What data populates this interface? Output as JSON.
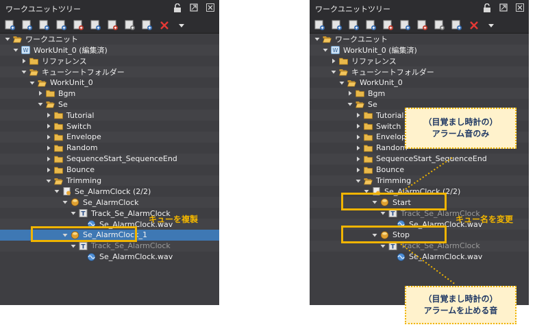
{
  "left_panel": {
    "title": "ワークユニットツリー",
    "rows": [
      {
        "label": "ワークユニット",
        "depth": 0,
        "icon": "folder-open",
        "arrow": "down"
      },
      {
        "label": "WorkUnit_0 (編集済)",
        "depth": 1,
        "icon": "workunit",
        "arrow": "down"
      },
      {
        "label": "リファレンス",
        "depth": 2,
        "icon": "folder",
        "arrow": "right"
      },
      {
        "label": "キューシートフォルダー",
        "depth": 2,
        "icon": "folder-open",
        "arrow": "down"
      },
      {
        "label": "WorkUnit_0",
        "depth": 3,
        "icon": "folder-open",
        "arrow": "down"
      },
      {
        "label": "Bgm",
        "depth": 4,
        "icon": "folder",
        "arrow": "right"
      },
      {
        "label": "Se",
        "depth": 4,
        "icon": "folder-open",
        "arrow": "down"
      },
      {
        "label": "Tutorial",
        "depth": 5,
        "icon": "folder",
        "arrow": "right"
      },
      {
        "label": "Switch",
        "depth": 5,
        "icon": "folder",
        "arrow": "right"
      },
      {
        "label": "Envelope",
        "depth": 5,
        "icon": "folder",
        "arrow": "right"
      },
      {
        "label": "Random",
        "depth": 5,
        "icon": "folder",
        "arrow": "right"
      },
      {
        "label": "SequenceStart_SequenceEnd",
        "depth": 5,
        "icon": "folder",
        "arrow": "right"
      },
      {
        "label": "Bounce",
        "depth": 5,
        "icon": "folder",
        "arrow": "right"
      },
      {
        "label": "Trimming",
        "depth": 5,
        "icon": "folder-open",
        "arrow": "down"
      },
      {
        "label": "Se_AlarmClock (2/2)",
        "depth": 6,
        "icon": "cuesheet",
        "arrow": "down"
      },
      {
        "label": "Se_AlarmClock",
        "depth": 7,
        "icon": "cue",
        "arrow": "down"
      },
      {
        "label": "Track_Se_AlarmClock",
        "depth": 8,
        "icon": "track",
        "arrow": "down"
      },
      {
        "label": "Se_AlarmClock.wav",
        "depth": 9,
        "icon": "wave",
        "arrow": "none"
      },
      {
        "label": "Se_AlarmClock_1",
        "depth": 7,
        "icon": "cue",
        "arrow": "down",
        "selected": true
      },
      {
        "label": "Track_Se_AlarmClock",
        "depth": 8,
        "icon": "track",
        "arrow": "down",
        "dim": true
      },
      {
        "label": "Se_AlarmClock.wav",
        "depth": 9,
        "icon": "wave",
        "arrow": "none"
      }
    ],
    "annotation": "キューを複製"
  },
  "right_panel": {
    "title": "ワークユニットツリー",
    "rows": [
      {
        "label": "ワークユニット",
        "depth": 0,
        "icon": "folder-open",
        "arrow": "down"
      },
      {
        "label": "WorkUnit_0 (編集済)",
        "depth": 1,
        "icon": "workunit",
        "arrow": "down"
      },
      {
        "label": "リファレンス",
        "depth": 2,
        "icon": "folder",
        "arrow": "right"
      },
      {
        "label": "キューシートフォルダー",
        "depth": 2,
        "icon": "folder-open",
        "arrow": "down"
      },
      {
        "label": "WorkUnit_0",
        "depth": 3,
        "icon": "folder-open",
        "arrow": "down"
      },
      {
        "label": "Bgm",
        "depth": 4,
        "icon": "folder",
        "arrow": "right"
      },
      {
        "label": "Se",
        "depth": 4,
        "icon": "folder-open",
        "arrow": "down"
      },
      {
        "label": "Tutorial",
        "depth": 5,
        "icon": "folder",
        "arrow": "right"
      },
      {
        "label": "Switch",
        "depth": 5,
        "icon": "folder",
        "arrow": "right"
      },
      {
        "label": "Envelope",
        "depth": 5,
        "icon": "folder",
        "arrow": "right"
      },
      {
        "label": "Random",
        "depth": 5,
        "icon": "folder",
        "arrow": "right"
      },
      {
        "label": "SequenceStart_SequenceEnd",
        "depth": 5,
        "icon": "folder",
        "arrow": "right"
      },
      {
        "label": "Bounce",
        "depth": 5,
        "icon": "folder",
        "arrow": "right"
      },
      {
        "label": "Trimming",
        "depth": 5,
        "icon": "folder-open",
        "arrow": "down"
      },
      {
        "label": "Se_AlarmClock (2/2)",
        "depth": 6,
        "icon": "cuesheet",
        "arrow": "down"
      },
      {
        "label": "Start",
        "depth": 7,
        "icon": "cue",
        "arrow": "down"
      },
      {
        "label": "Track_Se_AlarmClock",
        "depth": 8,
        "icon": "track",
        "arrow": "down",
        "dim": true
      },
      {
        "label": "Se_AlarmClock.wav",
        "depth": 9,
        "icon": "wave",
        "arrow": "none"
      },
      {
        "label": "Stop",
        "depth": 7,
        "icon": "cue",
        "arrow": "down"
      },
      {
        "label": "Track_Se_AlarmClock",
        "depth": 8,
        "icon": "track",
        "arrow": "down",
        "dim": true
      },
      {
        "label": "Se_AlarmClock.wav",
        "depth": 9,
        "icon": "wave",
        "arrow": "none"
      }
    ],
    "annotation": "キュー名を変更",
    "callout_top": [
      "（目覚まし時計の）",
      "アラーム音のみ"
    ],
    "callout_bottom": [
      "（目覚まし時計の）",
      "アラームを止める音"
    ]
  },
  "colors": {
    "panel": "#3e3e42",
    "titlebar": "#2d2d30",
    "selection": "#3e78b4",
    "accent": "#f0b400",
    "callout_fill": "#fff2cc",
    "callout_text": "#1f3864"
  }
}
